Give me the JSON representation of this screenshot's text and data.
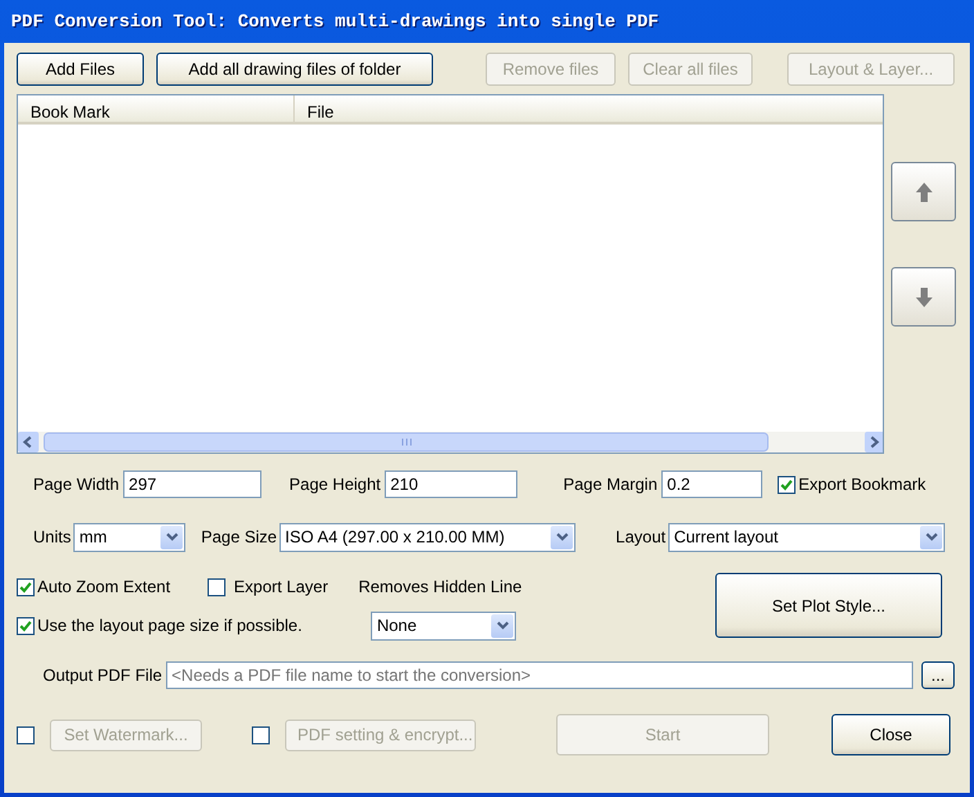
{
  "window": {
    "title": "PDF Conversion Tool: Converts multi-drawings into single PDF"
  },
  "toolbar": [
    {
      "label": "Add Files",
      "disabled": false
    },
    {
      "label": "Add all drawing files of folder",
      "disabled": false
    },
    {
      "label": "Remove files",
      "disabled": true
    },
    {
      "label": "Clear all files",
      "disabled": true
    },
    {
      "label": "Layout & Layer...",
      "disabled": true
    }
  ],
  "file_list": {
    "columns": [
      "Book Mark",
      "File"
    ]
  },
  "page_fields": [
    {
      "label": "Page Width",
      "value": "297"
    },
    {
      "label": "Page Height",
      "value": "210"
    },
    {
      "label": "Page Margin",
      "value": "0.2"
    }
  ],
  "export_bookmark": {
    "label": "Export Bookmark",
    "checked": true
  },
  "selects": [
    {
      "label": "Units",
      "value": "mm"
    },
    {
      "label": "Page Size",
      "value": "ISO A4 (297.00 x 210.00 MM)"
    },
    {
      "label": "Layout",
      "value": "Current layout"
    }
  ],
  "options": [
    {
      "label": "Auto Zoom Extent",
      "checked": true
    },
    {
      "label": "Export Layer",
      "checked": false
    },
    {
      "label": "Use the layout page size if possible.",
      "checked": true
    }
  ],
  "hidden_line": {
    "label": "Removes Hidden Line",
    "value": "None"
  },
  "plot_style_button": "Set Plot Style...",
  "output": {
    "label": "Output PDF File",
    "placeholder": "<Needs a PDF file name to start the conversion>",
    "browse": "..."
  },
  "bottom": [
    {
      "label": "Set Watermark...",
      "checked": false,
      "disabled": true
    },
    {
      "label": "PDF setting & encrypt...",
      "checked": false,
      "disabled": true
    }
  ],
  "start": {
    "label": "Start",
    "disabled": true
  },
  "close": {
    "label": "Close"
  }
}
